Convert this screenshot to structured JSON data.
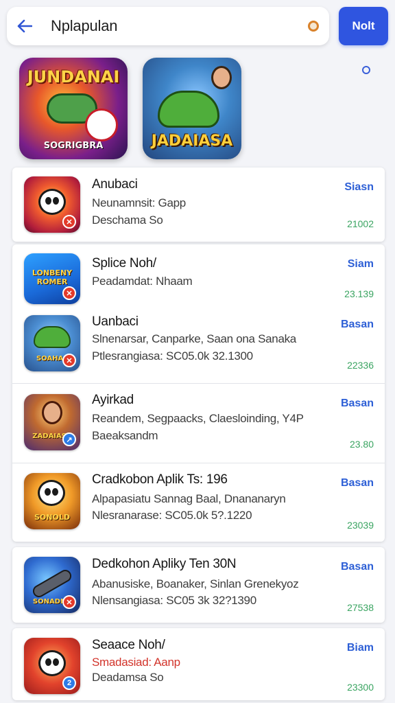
{
  "search": {
    "back_icon": "arrow-left-icon",
    "query": "Nplapulan",
    "button_label": "Nolt",
    "accent_color": "#2f55e0"
  },
  "featured": [
    {
      "top_title": "JUNDANAI",
      "bottom_title": "SOGRIGBRA"
    },
    {
      "bottom_title": "JADAIASA"
    }
  ],
  "cards": [
    {
      "rows": [
        {
          "title": "Anubaci",
          "subtitle": "Neunamnsit: Gapp",
          "meta": "Deschama So",
          "action": "Siasn",
          "count": "21002",
          "badge": "✕"
        }
      ]
    },
    {
      "rows": [
        {
          "title": "Splice Noh/",
          "subtitle": "Peadamdat: Nhaam",
          "action": "Siam",
          "count": "23.139",
          "badge": "✕",
          "icon_text": "LONBENY ROMER"
        },
        {
          "title": "Uanbaci",
          "subtitle": "Slnenarsar, Canparke, Saan ona Sanaka",
          "meta": "Ptlesrangiasa: SC05.0k 32.1300",
          "action": "Basan",
          "count": "22336",
          "badge": "✕",
          "icon_text": "SOAHAE"
        },
        {
          "title": "Ayirkad",
          "subtitle": "Reandem, Segpaacks, Claesloinding, Y4P",
          "meta": "Baeaksandm",
          "action": "Basan",
          "count": "23.80",
          "badge": "↗",
          "icon_text": "ZADAIASA"
        },
        {
          "title": "Cradkobon Aplik Ts: 196",
          "subtitle": "Alpapasiatu Sannag Baal, Dnananaryn",
          "meta": "Nlesranarase: SC05.0k 5?.1220",
          "action": "Basan",
          "count": "23039",
          "badge": "",
          "icon_text": "SONOLD"
        }
      ]
    },
    {
      "rows": [
        {
          "title": "Dedkohon Apliky Ten 30N",
          "subtitle": "Abanusiske, Boanaker, Sinlan Grenekyoz",
          "meta": "Nlensangiasa: SC05 3k 32?1390",
          "action": "Basan",
          "count": "27538",
          "badge": "✕",
          "icon_text": "SONADNA"
        }
      ]
    },
    {
      "rows": [
        {
          "title": "Seaace Noh/",
          "subtitle": "Smadasiad: Aanp",
          "meta": "Deadamsa So",
          "action": "Biam",
          "count": "23300",
          "badge": "2"
        }
      ]
    }
  ],
  "pager": {
    "icon": "circle-indicator-icon"
  }
}
